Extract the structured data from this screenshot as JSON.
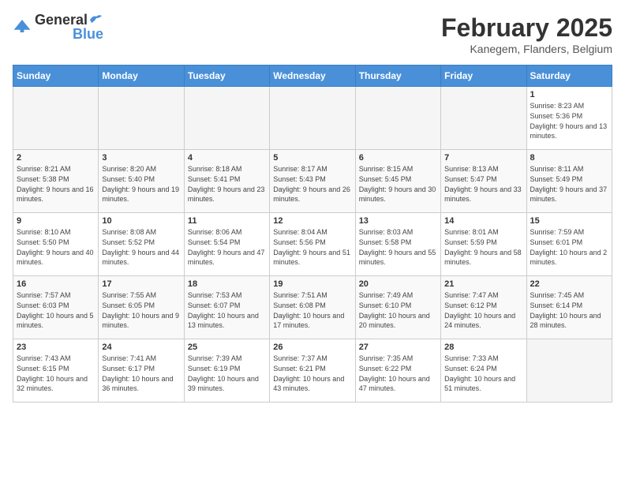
{
  "header": {
    "logo_general": "General",
    "logo_blue": "Blue",
    "title": "February 2025",
    "subtitle": "Kanegem, Flanders, Belgium"
  },
  "weekdays": [
    "Sunday",
    "Monday",
    "Tuesday",
    "Wednesday",
    "Thursday",
    "Friday",
    "Saturday"
  ],
  "weeks": [
    [
      {
        "day": "",
        "info": ""
      },
      {
        "day": "",
        "info": ""
      },
      {
        "day": "",
        "info": ""
      },
      {
        "day": "",
        "info": ""
      },
      {
        "day": "",
        "info": ""
      },
      {
        "day": "",
        "info": ""
      },
      {
        "day": "1",
        "info": "Sunrise: 8:23 AM\nSunset: 5:36 PM\nDaylight: 9 hours and 13 minutes."
      }
    ],
    [
      {
        "day": "2",
        "info": "Sunrise: 8:21 AM\nSunset: 5:38 PM\nDaylight: 9 hours and 16 minutes."
      },
      {
        "day": "3",
        "info": "Sunrise: 8:20 AM\nSunset: 5:40 PM\nDaylight: 9 hours and 19 minutes."
      },
      {
        "day": "4",
        "info": "Sunrise: 8:18 AM\nSunset: 5:41 PM\nDaylight: 9 hours and 23 minutes."
      },
      {
        "day": "5",
        "info": "Sunrise: 8:17 AM\nSunset: 5:43 PM\nDaylight: 9 hours and 26 minutes."
      },
      {
        "day": "6",
        "info": "Sunrise: 8:15 AM\nSunset: 5:45 PM\nDaylight: 9 hours and 30 minutes."
      },
      {
        "day": "7",
        "info": "Sunrise: 8:13 AM\nSunset: 5:47 PM\nDaylight: 9 hours and 33 minutes."
      },
      {
        "day": "8",
        "info": "Sunrise: 8:11 AM\nSunset: 5:49 PM\nDaylight: 9 hours and 37 minutes."
      }
    ],
    [
      {
        "day": "9",
        "info": "Sunrise: 8:10 AM\nSunset: 5:50 PM\nDaylight: 9 hours and 40 minutes."
      },
      {
        "day": "10",
        "info": "Sunrise: 8:08 AM\nSunset: 5:52 PM\nDaylight: 9 hours and 44 minutes."
      },
      {
        "day": "11",
        "info": "Sunrise: 8:06 AM\nSunset: 5:54 PM\nDaylight: 9 hours and 47 minutes."
      },
      {
        "day": "12",
        "info": "Sunrise: 8:04 AM\nSunset: 5:56 PM\nDaylight: 9 hours and 51 minutes."
      },
      {
        "day": "13",
        "info": "Sunrise: 8:03 AM\nSunset: 5:58 PM\nDaylight: 9 hours and 55 minutes."
      },
      {
        "day": "14",
        "info": "Sunrise: 8:01 AM\nSunset: 5:59 PM\nDaylight: 9 hours and 58 minutes."
      },
      {
        "day": "15",
        "info": "Sunrise: 7:59 AM\nSunset: 6:01 PM\nDaylight: 10 hours and 2 minutes."
      }
    ],
    [
      {
        "day": "16",
        "info": "Sunrise: 7:57 AM\nSunset: 6:03 PM\nDaylight: 10 hours and 5 minutes."
      },
      {
        "day": "17",
        "info": "Sunrise: 7:55 AM\nSunset: 6:05 PM\nDaylight: 10 hours and 9 minutes."
      },
      {
        "day": "18",
        "info": "Sunrise: 7:53 AM\nSunset: 6:07 PM\nDaylight: 10 hours and 13 minutes."
      },
      {
        "day": "19",
        "info": "Sunrise: 7:51 AM\nSunset: 6:08 PM\nDaylight: 10 hours and 17 minutes."
      },
      {
        "day": "20",
        "info": "Sunrise: 7:49 AM\nSunset: 6:10 PM\nDaylight: 10 hours and 20 minutes."
      },
      {
        "day": "21",
        "info": "Sunrise: 7:47 AM\nSunset: 6:12 PM\nDaylight: 10 hours and 24 minutes."
      },
      {
        "day": "22",
        "info": "Sunrise: 7:45 AM\nSunset: 6:14 PM\nDaylight: 10 hours and 28 minutes."
      }
    ],
    [
      {
        "day": "23",
        "info": "Sunrise: 7:43 AM\nSunset: 6:15 PM\nDaylight: 10 hours and 32 minutes."
      },
      {
        "day": "24",
        "info": "Sunrise: 7:41 AM\nSunset: 6:17 PM\nDaylight: 10 hours and 36 minutes."
      },
      {
        "day": "25",
        "info": "Sunrise: 7:39 AM\nSunset: 6:19 PM\nDaylight: 10 hours and 39 minutes."
      },
      {
        "day": "26",
        "info": "Sunrise: 7:37 AM\nSunset: 6:21 PM\nDaylight: 10 hours and 43 minutes."
      },
      {
        "day": "27",
        "info": "Sunrise: 7:35 AM\nSunset: 6:22 PM\nDaylight: 10 hours and 47 minutes."
      },
      {
        "day": "28",
        "info": "Sunrise: 7:33 AM\nSunset: 6:24 PM\nDaylight: 10 hours and 51 minutes."
      },
      {
        "day": "",
        "info": ""
      }
    ]
  ]
}
